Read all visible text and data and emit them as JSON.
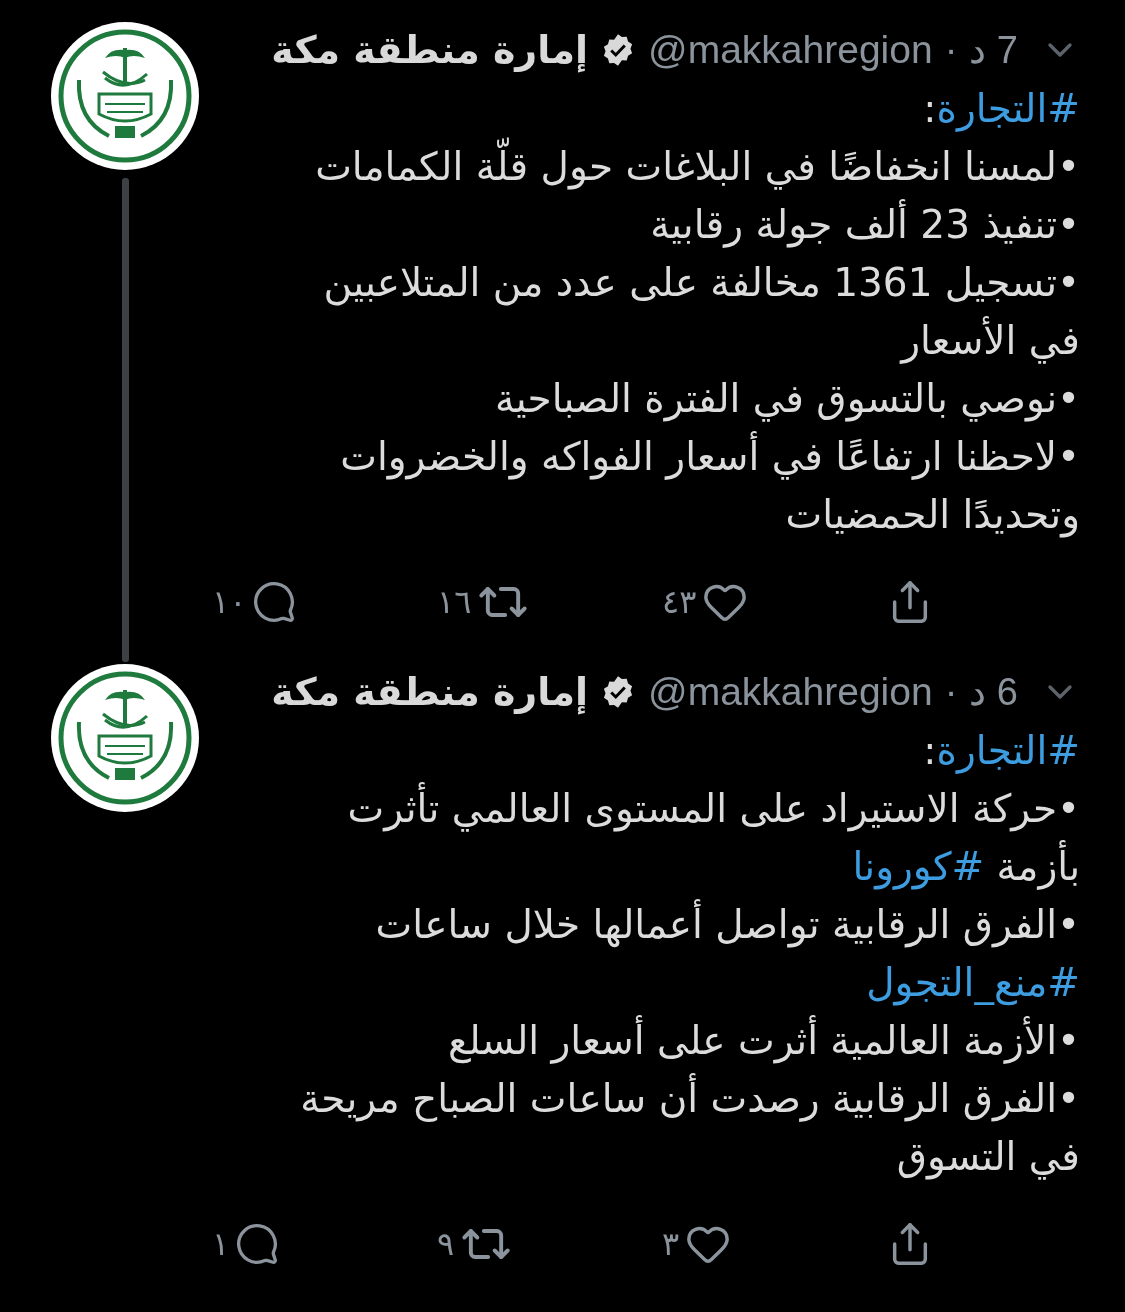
{
  "tweets": [
    {
      "name": "إمارة منطقة مكة",
      "verified": true,
      "handle": "@makkahregion",
      "separator": "·",
      "time": "7 د",
      "connected": true,
      "paragraphs": [
        [
          {
            "kind": "hashtag",
            "text": "#التجارة"
          },
          {
            "kind": "plain",
            "text": ":"
          }
        ],
        [
          {
            "kind": "plain",
            "text": "•لمسنا انخفاضًا في البلاغات حول قلّة الكمامات"
          }
        ],
        [
          {
            "kind": "plain",
            "text": "•تنفيذ 23 ألف جولة رقابية"
          }
        ],
        [
          {
            "kind": "plain",
            "text": "•تسجيل 1361 مخالفة على عدد من المتلاعبين في الأسعار"
          }
        ],
        [
          {
            "kind": "plain",
            "text": "•نوصي بالتسوق في الفترة الصباحية"
          }
        ],
        [
          {
            "kind": "plain",
            "text": "•لاحظنا ارتفاعًا في أسعار الفواكه والخضروات وتحديدًا الحمضيات"
          }
        ]
      ],
      "replies": "١٠",
      "retweets": "١٦",
      "likes": "٤٣"
    },
    {
      "name": "إمارة منطقة مكة",
      "verified": true,
      "handle": "@makkahregion",
      "separator": "·",
      "time": "6 د",
      "connected": false,
      "paragraphs": [
        [
          {
            "kind": "hashtag",
            "text": "#التجارة"
          },
          {
            "kind": "plain",
            "text": ":"
          }
        ],
        [
          {
            "kind": "plain",
            "text": "•حركة الاستيراد على المستوى العالمي تأثرت بأزمة "
          },
          {
            "kind": "hashtag",
            "text": "#كورونا"
          }
        ],
        [
          {
            "kind": "plain",
            "text": "•الفرق الرقابية تواصل أعمالها خلال ساعات "
          },
          {
            "kind": "hashtag",
            "text": "#منع_التجول"
          }
        ],
        [
          {
            "kind": "plain",
            "text": "•الأزمة العالمية أثرت على أسعار السلع"
          }
        ],
        [
          {
            "kind": "plain",
            "text": "•الفرق الرقابية رصدت أن ساعات الصباح مريحة في التسوق"
          }
        ]
      ],
      "replies": "١",
      "retweets": "٩",
      "likes": "٣"
    }
  ]
}
